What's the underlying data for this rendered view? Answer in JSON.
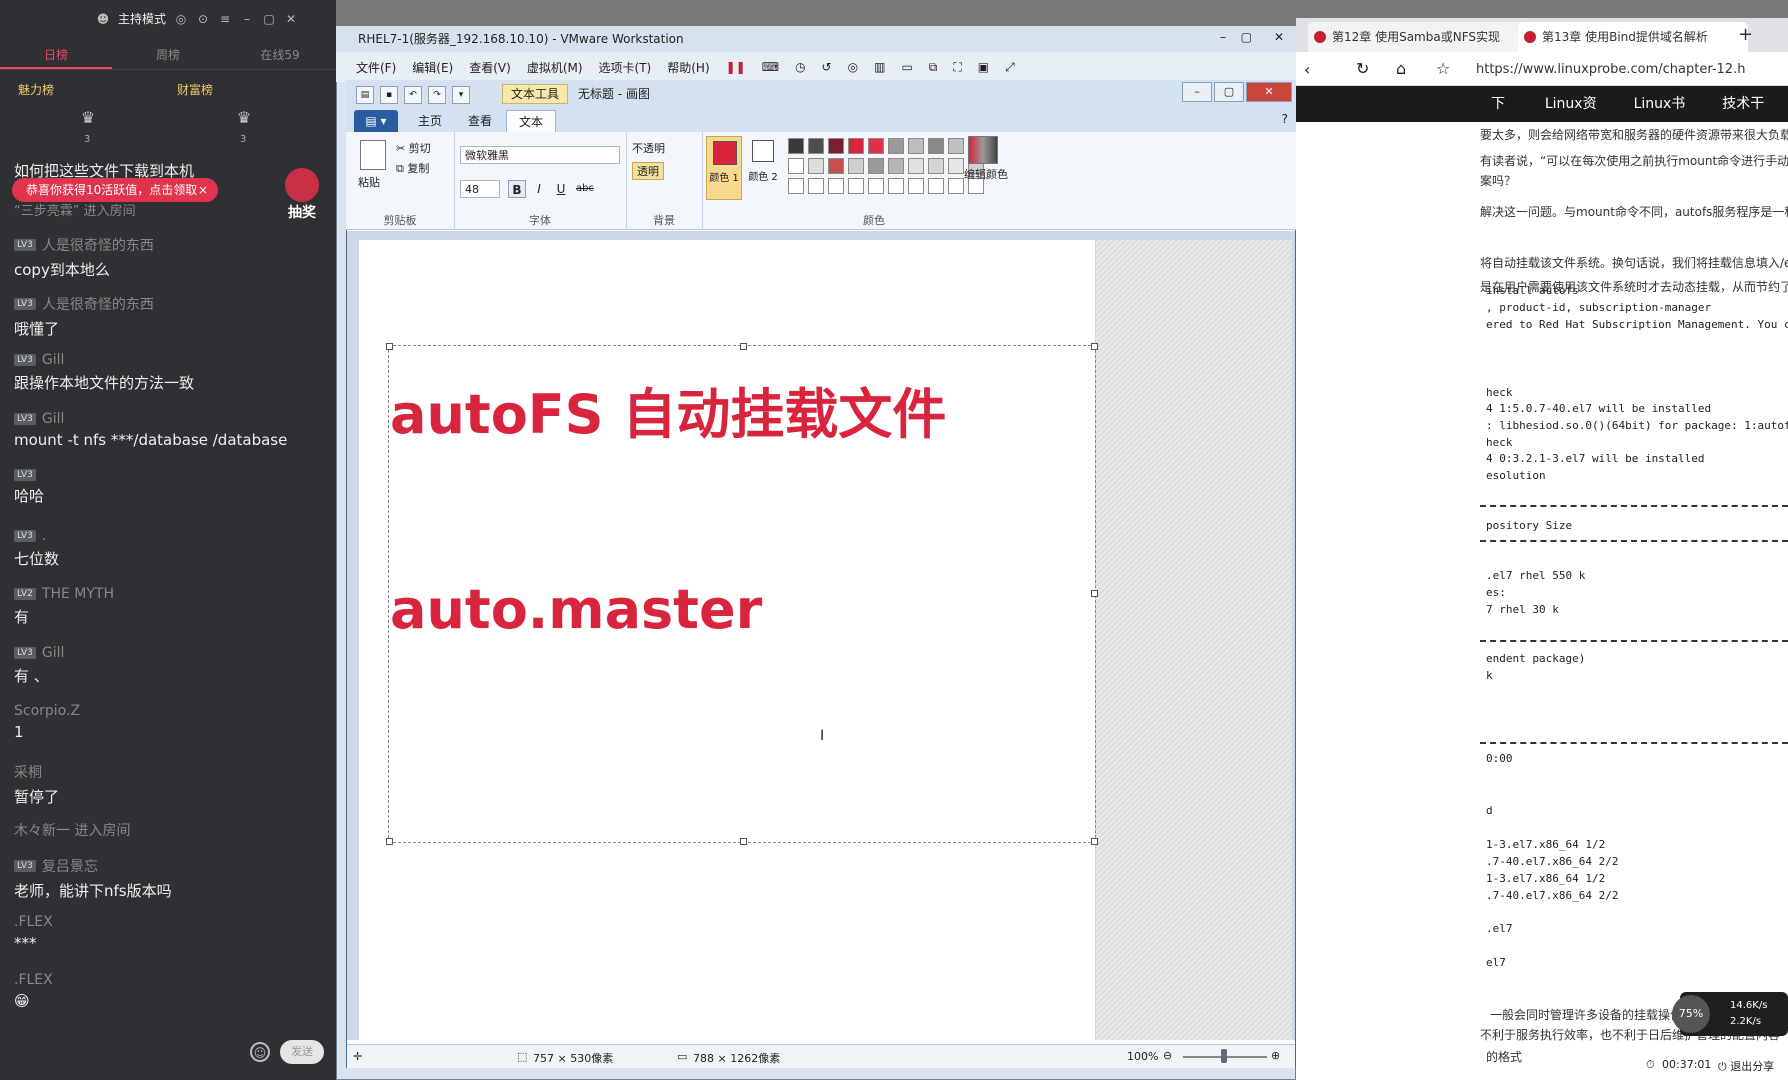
{
  "chat": {
    "host_mode": "主持模式",
    "tabs": [
      "日榜",
      "周榜",
      "在线59"
    ],
    "subtabs": [
      "魅力榜",
      "财富榜"
    ],
    "rank_counts": [
      "3",
      "3"
    ],
    "header_question": "如何把这些文件下载到本机",
    "promo": "恭喜你获得10活跃值，点击领取",
    "promo_close": "×",
    "entered": "“三步亮霖” 进入房间",
    "lottery": "抽奖",
    "messages": [
      {
        "level": "LV3",
        "user": "人是很奇怪的东西",
        "text": "copy到本地么"
      },
      {
        "level": "LV3",
        "user": "人是很奇怪的东西",
        "text": "哦懂了"
      },
      {
        "level": "LV3",
        "user": "Gill",
        "text": "跟操作本地文件的方法一致"
      },
      {
        "level": "LV3",
        "user": "Gill",
        "text": "mount -t nfs ***/database /database"
      },
      {
        "level": "LV3",
        "user": "",
        "text": "哈哈"
      },
      {
        "level": "LV3",
        "user": ".",
        "text": "七位数"
      },
      {
        "level": "LV2",
        "user": "THE MYTH",
        "text": "有"
      },
      {
        "level": "LV3",
        "user": "Gill",
        "text": "有 、"
      },
      {
        "level": "",
        "user": "Scorpio.Z",
        "text": "1"
      },
      {
        "level": "",
        "user": "采桐",
        "text": "暂停了"
      },
      {
        "level": "",
        "user": "木々新一 进入房间",
        "text": ""
      },
      {
        "level": "LV3",
        "user": "复吕景忘",
        "text": "老师，能讲下nfs版本吗"
      },
      {
        "level": "",
        "user": ".FLEX",
        "text": "***"
      },
      {
        "level": "",
        "user": ".FLEX",
        "text": "😁"
      }
    ],
    "send": "发送",
    "emoji_icon": "smile-icon"
  },
  "browser": {
    "tab1": "第12章 使用Samba或NFS实现",
    "tab2": "第13章 使用Bind提供域名解析",
    "tab_add": "+",
    "url": "https://www.linuxprobe.com/chapter-12.h",
    "nav": [
      "下载",
      "Linux资讯",
      "Linux书籍",
      "技术干货"
    ],
    "text_lines": [
      "要太多，则会给网络带宽和服务器的硬件资源带来很大负载。",
      "有读者说，“可以在每次使用之前执行mount命令进行手动挂",
      "案吗？",
      "解决这一问题。与mount命令不同，autofs服务程序是一种L",
      "将自动挂载该文件系统。换句话说，我们将挂载信息填入/etc",
      "是在用户需要使用该文件系统时才去动态挂载，从而节约了网"
    ],
    "code_lines": [
      "install autofs",
      ", product-id, subscription-manager",
      "ered to Red Hat Subscription Management. You c",
      "heck",
      "4 1:5.0.7-40.el7 will be installed",
      ": libhesiod.so.0()(64bit) for package: 1:autof",
      "heck",
      "4 0:3.2.1-3.el7 will be installed",
      "esolution",
      "pository          Size",
      ".el7   rhel   550 k",
      "es:",
      "7   rhel    30 k",
      "endent package)",
      "k",
      "0:00",
      "d",
      "1-3.el7.x86_64       1/2",
      ".7-40.el7.x86_64     2/2",
      "1-3.el7.x86_64       1/2",
      ".7-40.el7.x86_64     2/2",
      ".el7",
      "el7"
    ],
    "bottom_text": "一般会同时管理许多设备的挂载操作",
    "bottom_text2": "不利于服务执行效率，也不利于日后维护管理的配置内容",
    "bottom_text3": "的格式"
  },
  "vmware": {
    "title": "RHEL7-1(服务器_192.168.10.10) - VMware Workstation",
    "menu": [
      "文件(F)",
      "编辑(E)",
      "查看(V)",
      "虚拟机(M)",
      "选项卡(T)",
      "帮助(H)"
    ]
  },
  "paint": {
    "text_tools": "文本工具",
    "doc_title": "无标题 - 画图",
    "tabs": [
      "主页",
      "查看",
      "文本"
    ],
    "clipboard": {
      "paste": "粘贴",
      "cut": "剪切",
      "copy": "复制",
      "label": "剪贴板"
    },
    "font": {
      "name": "微软雅黑",
      "size": "48",
      "label": "字体",
      "bold": "B",
      "italic": "I",
      "underline": "U",
      "strike": "abc"
    },
    "background": {
      "opaque": "不透明",
      "transparent": "透明",
      "label": "背景"
    },
    "colors": {
      "color1": "颜色 1",
      "color2": "颜色 2",
      "edit": "编辑颜色",
      "label": "颜色"
    },
    "palette_row1": [
      "#3a3a3a",
      "#4d4d4d",
      "#7a1f2b",
      "#d9243e",
      "#e0304a",
      "#9a9a9a",
      "#bdbdbd",
      "#888888",
      "#c0c0c0",
      "#555555",
      "#b0303f"
    ],
    "palette_row2": [
      "#ffffff",
      "#dcdcdc",
      "#c8504f",
      "#d0d0d0",
      "#9a9a9a",
      "#b5b5b5",
      "#e0e0e0",
      "#d5d5d5",
      "#e6e6e6",
      "#cfcfcf",
      "#eeeeee"
    ],
    "palette_row3": [
      "#ffffff",
      "#ffffff",
      "#ffffff",
      "#ffffff",
      "#ffffff",
      "#ffffff",
      "#ffffff",
      "#ffffff",
      "#ffffff",
      "#ffffff",
      "#ffffff"
    ],
    "line1": "autoFS  自动挂载文件",
    "line2": "auto.master",
    "accent_color": "#d9243e",
    "status_selection": "757 × 530像素",
    "status_canvas": "788 × 1262像素",
    "zoom": "100%"
  },
  "overlay": {
    "percent": "75%",
    "up_speed": "14.6K/s",
    "down_speed": "2.2K/s",
    "timer": "00:37:01",
    "exit_share": "退出分享"
  }
}
